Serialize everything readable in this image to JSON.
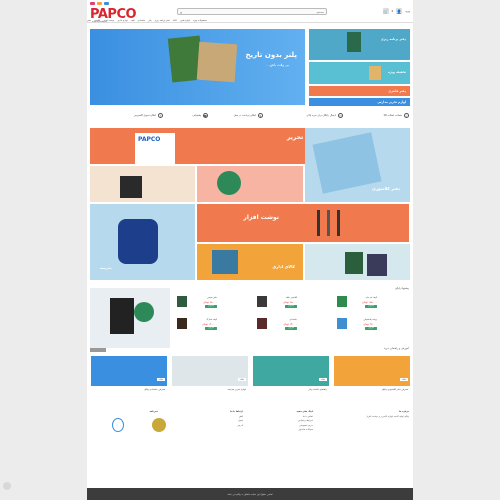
{
  "brand": {
    "logo_main": "PAP",
    "logo_accent": "CO",
    "tagline": "STATIONERY"
  },
  "search": {
    "placeholder": "جستجو"
  },
  "header": {
    "account": "ورود",
    "cart_count": "0"
  },
  "nav": {
    "items": [
      "دفتر",
      "کلاسور",
      "نوشت افزار",
      "لوازم اداری",
      "کیف",
      "جامدادی",
      "پلنر",
      "دفتر برنامه ریزی",
      "کاغذ",
      "لوازم هنری",
      "محصولات ویژه"
    ]
  },
  "hero": {
    "title": "پلنر بدون تاریخ",
    "subtitle": "بی وقت باش..."
  },
  "side_banners": [
    {
      "text": "دفتر برنامه ریزی"
    },
    {
      "text": "تخفیف ویژه"
    },
    {
      "text": "دفتر فانتزی"
    },
    {
      "text": "لوازم تحریر مدارس"
    }
  ],
  "features": [
    {
      "label": "ضمانت اصالت کالا"
    },
    {
      "label": "ارسال رایگان برای خرید بالای"
    },
    {
      "label": "امکان پرداخت در محل"
    },
    {
      "label": "پشتیبانی"
    },
    {
      "label": "امکان تحویل اکسپرس"
    }
  ],
  "promo": {
    "office": "کالای اداری",
    "stationery": "کالای تحریر",
    "binder": "دفتر کلاسوری",
    "notebook": "دفتر",
    "pen": "نوشت افزار",
    "school": "مدرسه",
    "product_box_label": "PAPCO"
  },
  "products": {
    "breadcrumb": "پیشنهاد پاپکو",
    "items": [
      {
        "name": "کیف لپ تاپ",
        "price": "۱۸۵,۰۰۰ تومان",
        "btn": "افزودن",
        "color": "#2f8a4e"
      },
      {
        "name": "کلاسور حلقه",
        "price": "۶۵,۰۰۰ تومان",
        "btn": "افزودن",
        "color": "#3a3a3a"
      },
      {
        "name": "دفتر سیمی",
        "price": "۹۸,۰۰۰ تومان",
        "btn": "افزودن",
        "color": "#2f5c3f"
      },
      {
        "name": "پوشه پلاستیکی",
        "price": "۲۷,۰۰۰ تومان",
        "btn": "افزودن",
        "color": "#3f8ecf"
      },
      {
        "name": "جامدادی",
        "price": "۴۳,۰۰۰ تومان",
        "btn": "افزودن",
        "color": "#5a2a2a"
      },
      {
        "name": "کیف مدارک",
        "price": "۱۲۰,۰۰۰ تومان",
        "btn": "افزودن",
        "color": "#3a2a1e"
      }
    ]
  },
  "blog": {
    "title": "آموزش و راهنمای خرید",
    "posts": [
      {
        "caption": "معرفی دفتر کلاسوری پاپکو",
        "tag": "مقاله"
      },
      {
        "caption": "راهنمای انتخاب پلنر",
        "tag": "مقاله"
      },
      {
        "caption": "لوازم تحریر مدرسه",
        "tag": "مقاله"
      },
      {
        "caption": "معرفی جامدادی پاپکو",
        "tag": "مقاله"
      }
    ]
  },
  "footer": {
    "about_title": "درباره ما",
    "about_text": "پاپکو تولید کننده لوازم التحریر و نوشت افزار",
    "links_title": "لینک های مفید",
    "links": [
      "تماس با ما",
      "شرایط و قوانین",
      "حریم خصوصی",
      "سوالات متداول"
    ],
    "contact_title": "ارتباط با ما",
    "contact": [
      "تلفن",
      "ایمیل",
      "آدرس"
    ],
    "newsletter_title": "خبرنامه",
    "copyright": "تمامی حقوق این سایت متعلق به پاپکو می باشد"
  },
  "colors": {
    "brand_blue": "#1f63c6",
    "brand_red": "#d8252f",
    "sky": "#3b8fe0",
    "orange": "#f47c4a",
    "teal": "#4fb8c4"
  }
}
